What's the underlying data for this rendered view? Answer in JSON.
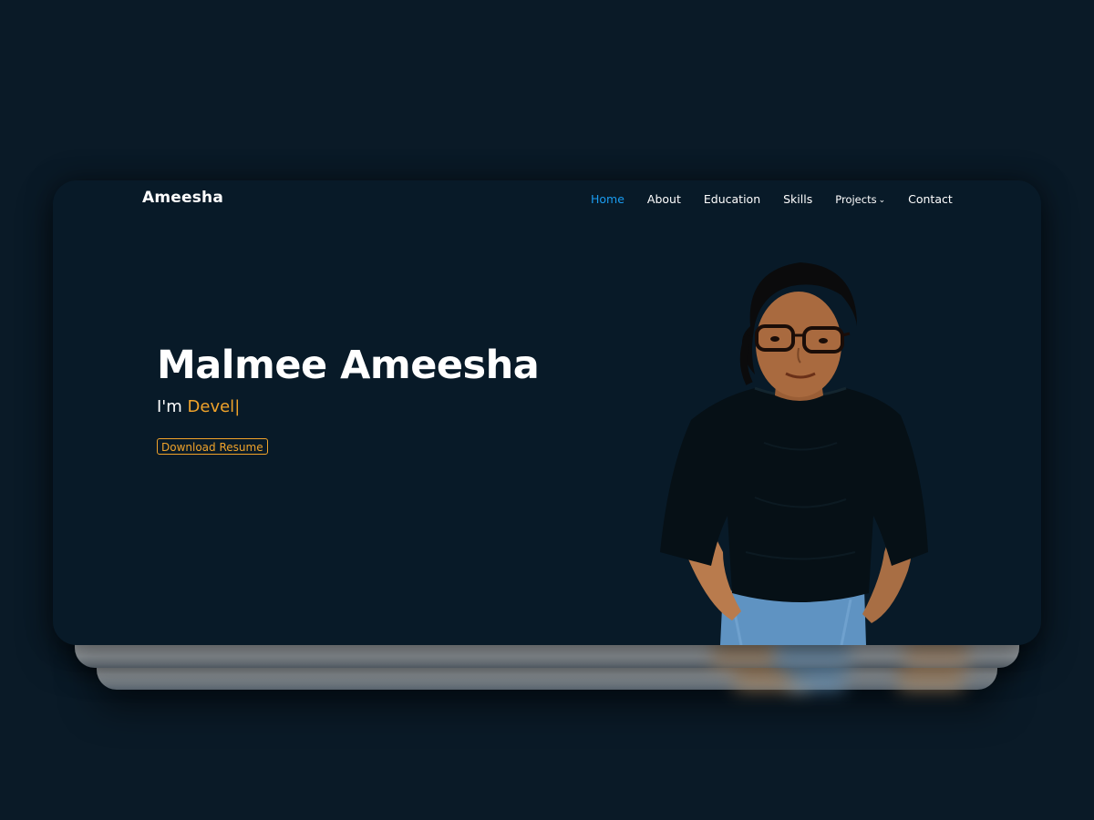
{
  "header": {
    "logo": "Ameesha"
  },
  "nav": {
    "items": [
      {
        "label": "Home",
        "active": true
      },
      {
        "label": "About",
        "active": false
      },
      {
        "label": "Education",
        "active": false
      },
      {
        "label": "Skills",
        "active": false
      },
      {
        "label": "Projects",
        "active": false,
        "dropdown": true
      },
      {
        "label": "Contact",
        "active": false
      }
    ],
    "dropdown_icon": "chevron-down-icon"
  },
  "hero": {
    "name": "Malmee Ameesha",
    "role_prefix": "I'm ",
    "role_typed": "Devel",
    "cursor": "|",
    "resume_button": "Download Resume"
  },
  "colors": {
    "background": "#0a1a27",
    "card": "#081a28",
    "accent": "#f0a32a",
    "nav_active": "#1a9bef",
    "text": "#ffffff"
  }
}
